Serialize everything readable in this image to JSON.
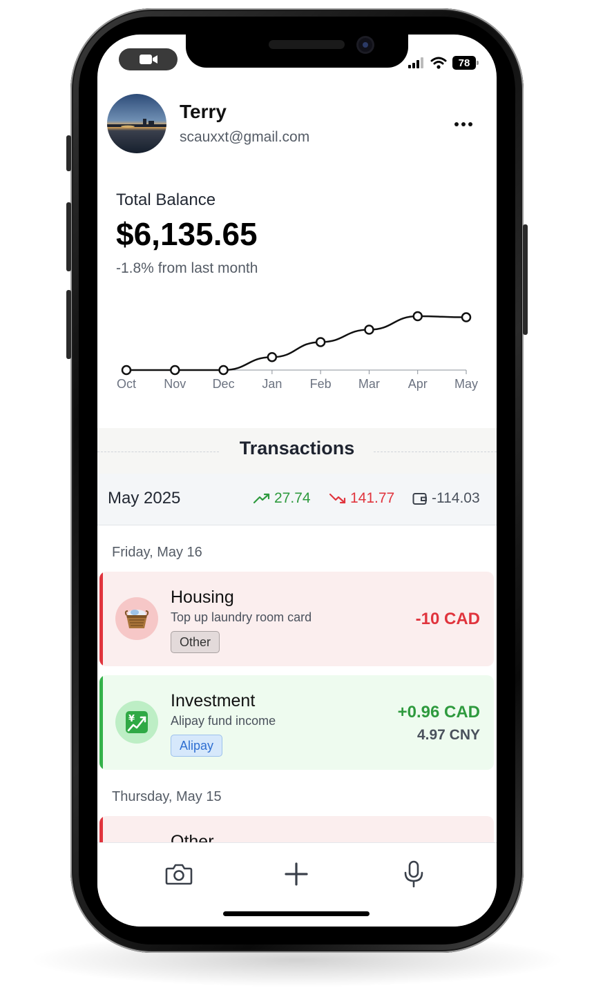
{
  "status_bar": {
    "battery": "78"
  },
  "profile": {
    "name": "Terry",
    "email": "scauxxt@gmail.com"
  },
  "balance": {
    "label": "Total Balance",
    "value": "$6,135.65",
    "change": "-1.8% from last month"
  },
  "chart_data": {
    "type": "line",
    "categories": [
      "Oct",
      "Nov",
      "Dec",
      "Jan",
      "Feb",
      "Mar",
      "Apr",
      "May"
    ],
    "values": [
      0,
      0,
      0,
      0.24,
      0.52,
      0.75,
      1.0,
      0.98
    ],
    "grid": false,
    "legend": "none"
  },
  "transactions": {
    "title": "Transactions",
    "month": "May 2025",
    "income": "27.74",
    "expense": "141.77",
    "net": "-114.03",
    "colors": {
      "income": "#2e9a3e",
      "expense": "#e0343d",
      "net": "#4a515c"
    },
    "days": [
      {
        "label": "Friday, May 16",
        "items": [
          {
            "category": "Housing",
            "description": "Top up laundry room card",
            "tag": "Other",
            "amount": "-10 CAD",
            "sub_amount": "",
            "icon": "laundry-basket-icon"
          },
          {
            "category": "Investment",
            "description": "Alipay fund income",
            "tag": "Alipay",
            "amount": "+0.96 CAD",
            "sub_amount": "4.97 CNY",
            "icon": "yen-chart-icon"
          }
        ]
      },
      {
        "label": "Thursday, May 15",
        "items": [
          {
            "category": "Other",
            "description": "",
            "tag": "",
            "amount": "",
            "sub_amount": "",
            "icon": ""
          }
        ]
      }
    ]
  },
  "bottom_actions": [
    "camera-icon",
    "plus-icon",
    "microphone-icon"
  ]
}
